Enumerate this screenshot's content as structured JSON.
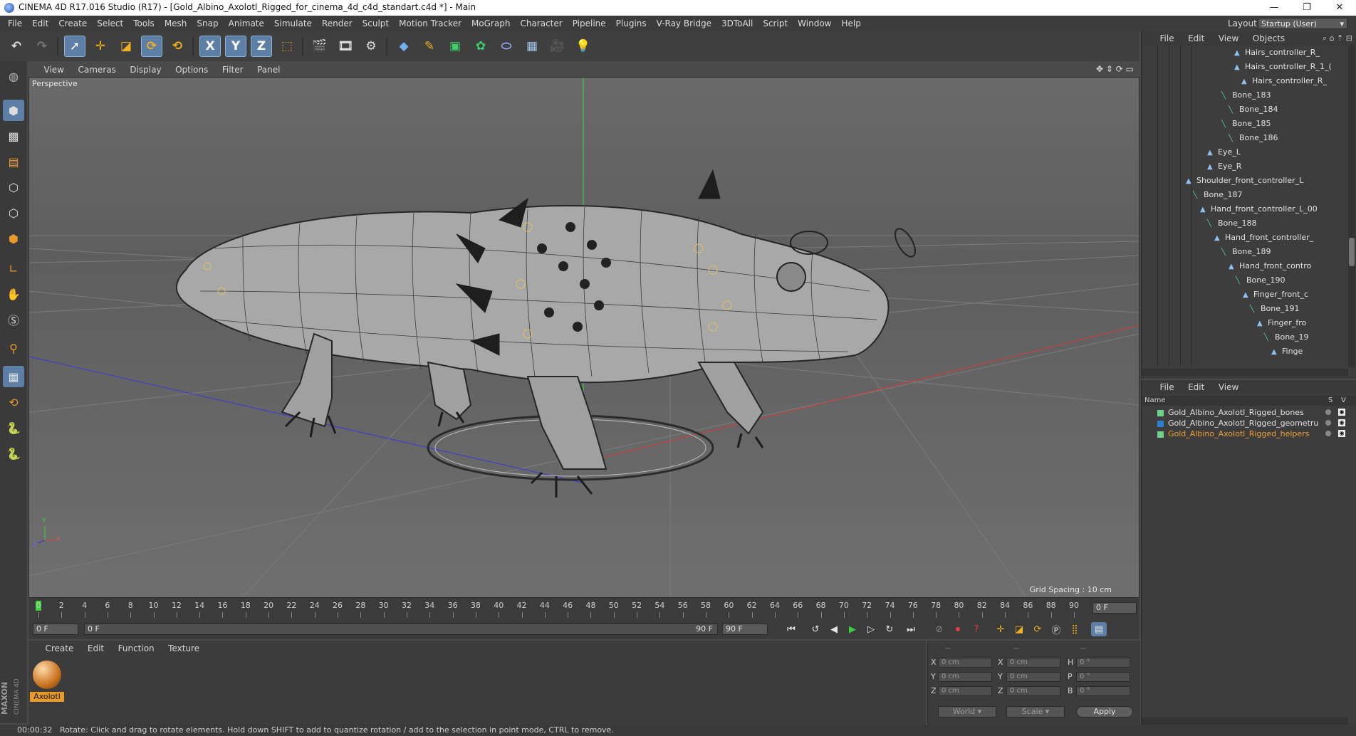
{
  "window": {
    "title": "CINEMA 4D R17.016 Studio (R17) - [Gold_Albino_Axolotl_Rigged_for_cinema_4d_c4d_standart.c4d *] - Main",
    "controls": [
      "—",
      "❐",
      "✕"
    ]
  },
  "menubar": {
    "items": [
      "File",
      "Edit",
      "Create",
      "Select",
      "Tools",
      "Mesh",
      "Snap",
      "Animate",
      "Simulate",
      "Render",
      "Sculpt",
      "Motion Tracker",
      "MoGraph",
      "Character",
      "Pipeline",
      "Plugins",
      "V-Ray Bridge",
      "3DToAll",
      "Script",
      "Window",
      "Help"
    ],
    "layout_label": "Layout:",
    "layout_value": "Startup (User)"
  },
  "toolbar": {
    "icons": [
      "undo-icon",
      "redo-icon",
      "live-selection-icon",
      "move-icon",
      "scale-icon",
      "rotate-icon",
      "recent-tool-icon",
      "x-axis-icon",
      "y-axis-icon",
      "z-axis-icon",
      "coordinate-system-icon",
      "render-view-icon",
      "render-picture-viewer-icon",
      "edit-render-settings-icon",
      "cube-icon",
      "pen-icon",
      "subdivision-icon",
      "cloner-icon",
      "deformer-icon",
      "floor-icon",
      "camera-icon",
      "light-icon"
    ],
    "axis_labels": [
      "X",
      "Y",
      "Z"
    ]
  },
  "viewport": {
    "menu": [
      "View",
      "Cameras",
      "Display",
      "Options",
      "Filter",
      "Panel"
    ],
    "label": "Perspective",
    "grid_spacing": "Grid Spacing : 10 cm",
    "axis_labels": {
      "y": "Y",
      "z": "Z",
      "x": "X"
    }
  },
  "timeline": {
    "ticks": [
      "0",
      "2",
      "4",
      "6",
      "8",
      "10",
      "12",
      "14",
      "16",
      "18",
      "20",
      "22",
      "24",
      "26",
      "28",
      "30",
      "32",
      "34",
      "36",
      "38",
      "40",
      "42",
      "44",
      "46",
      "48",
      "50",
      "52",
      "54",
      "56",
      "58",
      "60",
      "62",
      "64",
      "66",
      "68",
      "70",
      "72",
      "74",
      "76",
      "78",
      "80",
      "82",
      "84",
      "86",
      "88",
      "90"
    ],
    "current_frame": "0 F",
    "start_field": "0 F",
    "range_start": "0 F",
    "range_end": "90 F",
    "end_field": "90 F"
  },
  "material_manager": {
    "menu": [
      "Create",
      "Edit",
      "Function",
      "Texture"
    ],
    "material_name": "Axolotl"
  },
  "coordinates": {
    "headers": [
      "--",
      "--",
      "--"
    ],
    "rows": [
      {
        "l1": "X",
        "v1": "0 cm",
        "l2": "X",
        "v2": "0 cm",
        "l3": "H",
        "v3": "0 °"
      },
      {
        "l1": "Y",
        "v1": "0 cm",
        "l2": "Y",
        "v2": "0 cm",
        "l3": "P",
        "v3": "0 °"
      },
      {
        "l1": "Z",
        "v1": "0 cm",
        "l2": "Z",
        "v2": "0 cm",
        "l3": "B",
        "v3": "0 °"
      }
    ],
    "space_select": "World",
    "mode_select": "Scale",
    "apply_label": "Apply"
  },
  "object_manager": {
    "menu": [
      "File",
      "Edit",
      "View",
      "Objects"
    ],
    "rows": [
      {
        "label": "Hairs_controller_R_",
        "icon": "joint"
      },
      {
        "label": "Hairs_controller_R_1_(",
        "icon": "joint"
      },
      {
        "label": "Hairs_controller_R_",
        "icon": "joint"
      },
      {
        "label": "Bone_183",
        "icon": "bone"
      },
      {
        "label": "Bone_184",
        "icon": "bone"
      },
      {
        "label": "Bone_185",
        "icon": "bone"
      },
      {
        "label": "Bone_186",
        "icon": "bone"
      },
      {
        "label": "Eye_L",
        "icon": "joint"
      },
      {
        "label": "Eye_R",
        "icon": "joint"
      },
      {
        "label": "Shoulder_front_controller_L",
        "icon": "joint"
      },
      {
        "label": "Bone_187",
        "icon": "bone"
      },
      {
        "label": "Hand_front_controller_L_00",
        "icon": "joint"
      },
      {
        "label": "Bone_188",
        "icon": "bone"
      },
      {
        "label": "Hand_front_controller_",
        "icon": "joint"
      },
      {
        "label": "Bone_189",
        "icon": "bone"
      },
      {
        "label": "Hand_front_contro",
        "icon": "joint"
      },
      {
        "label": "Bone_190",
        "icon": "bone"
      },
      {
        "label": "Finger_front_c",
        "icon": "joint"
      },
      {
        "label": "Bone_191",
        "icon": "bone"
      },
      {
        "label": "Finger_fro",
        "icon": "joint"
      },
      {
        "label": "Bone_19",
        "icon": "bone"
      },
      {
        "label": "Finge",
        "icon": "joint"
      }
    ]
  },
  "layer_manager": {
    "menu": [
      "File",
      "Edit",
      "View"
    ],
    "col_name": "Name",
    "col_s": "S",
    "col_v": "V",
    "layers": [
      {
        "name": "Gold_Albino_Axolotl_Rigged_bones",
        "color": "#6fd08a",
        "active": false
      },
      {
        "name": "Gold_Albino_Axolotl_Rigged_geometru",
        "color": "#2a7fd0",
        "active": false
      },
      {
        "name": "Gold_Albino_Axolotl_Rigged_helpers",
        "color": "#6fd08a",
        "active": true
      }
    ]
  },
  "statusbar": {
    "time": "00:00:32",
    "message": "Rotate: Click and drag to rotate elements. Hold down SHIFT to add to quantize rotation / add to the selection in point mode, CTRL to remove."
  },
  "branding": "MAXON CINEMA 4D",
  "colors": {
    "selected_tool": "#5d7fa6",
    "active_layer_text": "#f0a030",
    "play_green": "#3ccf3c"
  }
}
